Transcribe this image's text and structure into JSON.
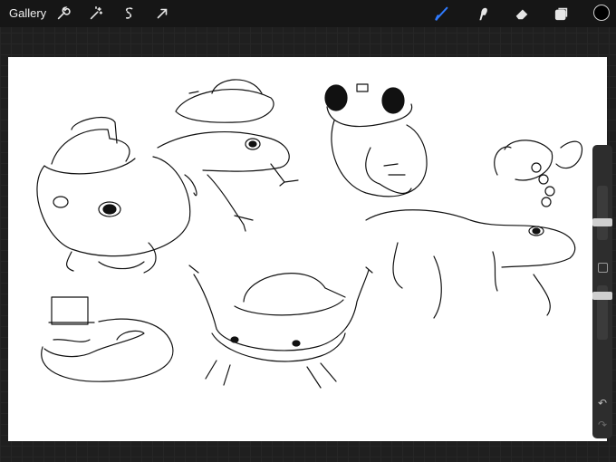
{
  "app": {
    "gallery_label": "Gallery"
  },
  "toolbar": {
    "left_tools": [
      "wrench-icon",
      "magic-wand-icon",
      "selection-s-icon",
      "transform-arrow-icon"
    ],
    "right_tools": [
      "brush-icon",
      "smudge-icon",
      "eraser-icon",
      "layers-icon"
    ],
    "active_tool": "brush-icon",
    "active_tool_color": "#2f7bff",
    "current_color": "#000000"
  },
  "sidebar": {
    "brush_size_level": 0.15,
    "opacity_level": 0.0,
    "undo_icon": "undo-arrow-icon",
    "redo_icon": "redo-arrow-icon"
  },
  "canvas": {
    "background": "#ffffff",
    "drawings": [
      "frog-with-cowboy-hat-icon",
      "leaping-frog-with-hat-icon",
      "frog-with-big-eyes-icon",
      "horned-lizard-icon",
      "snake-with-top-hat-icon",
      "crab-with-hat-icon"
    ]
  }
}
